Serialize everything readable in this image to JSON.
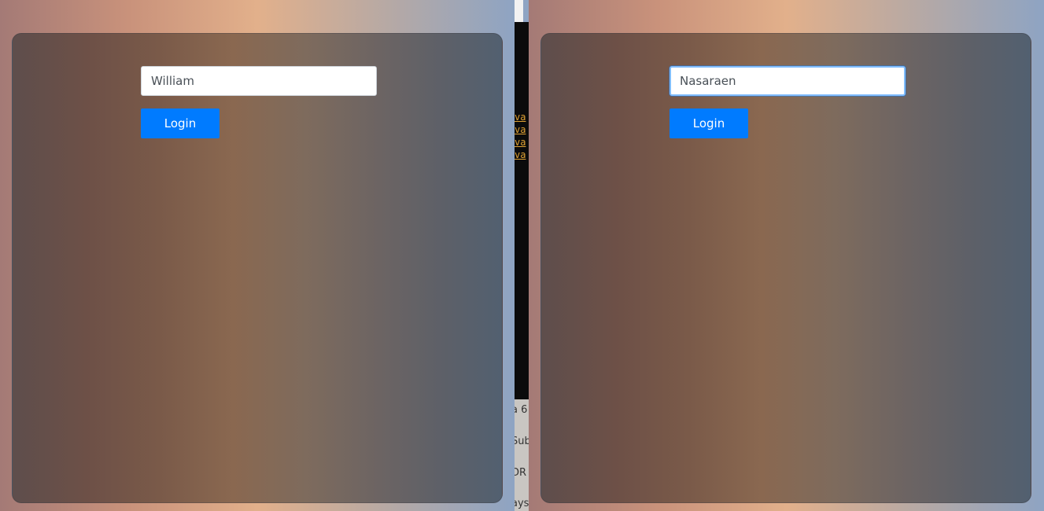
{
  "left_panel": {
    "name_input": {
      "value": "William",
      "placeholder": ""
    },
    "login_label": "Login"
  },
  "right_panel": {
    "name_input": {
      "value": "Nasaraen",
      "placeholder": ""
    },
    "login_label": "Login"
  },
  "background_window": {
    "code_lines": [
      "va",
      "va",
      "va",
      "va"
    ],
    "text_fragments": [
      "a 6",
      "Sub",
      "DR",
      "ays"
    ]
  },
  "colors": {
    "button": "#007bff",
    "focus_ring": "#80bdff"
  }
}
